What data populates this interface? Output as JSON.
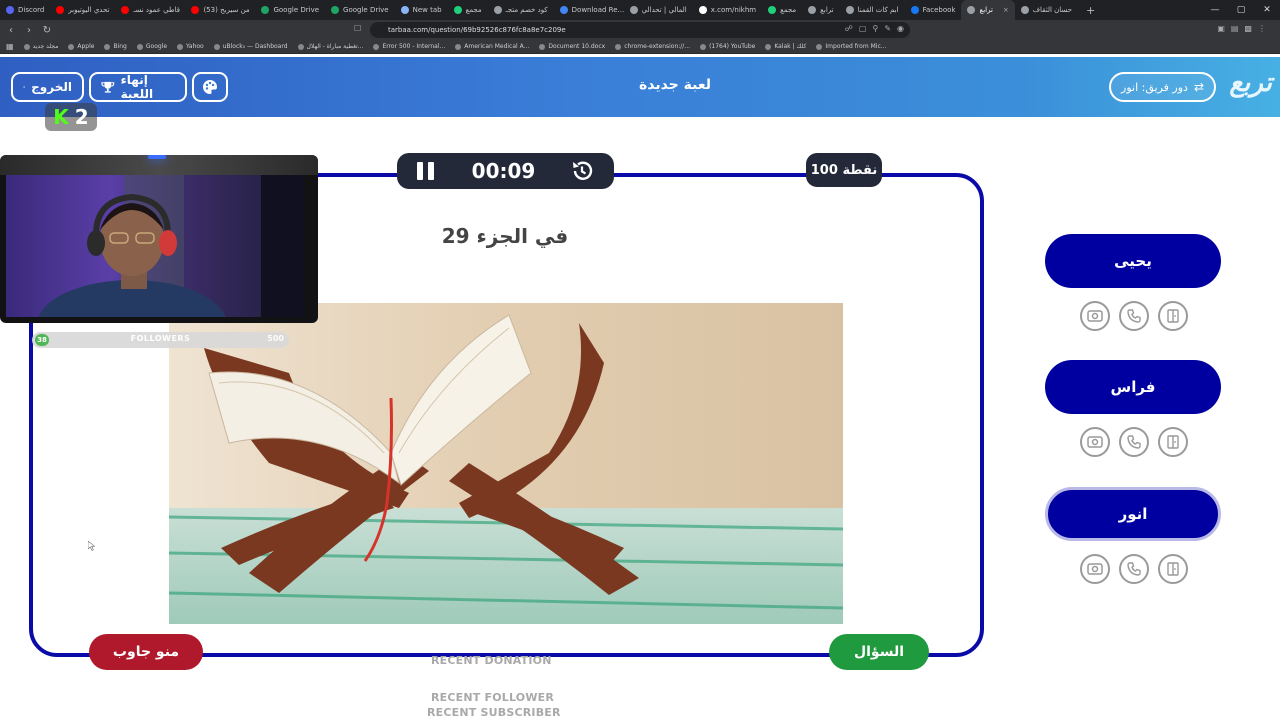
{
  "browser": {
    "tabs": [
      {
        "label": "Discord",
        "color": "#5865f2"
      },
      {
        "label": "تحدي اليوتيوبر",
        "color": "#ff0000"
      },
      {
        "label": "قاطي عمود نسـ",
        "color": "#ff0000"
      },
      {
        "label": "(53) من سيربح",
        "color": "#ff0000"
      },
      {
        "label": "Google Drive",
        "color": "#1fa463"
      },
      {
        "label": "Google Drive",
        "color": "#1fa463"
      },
      {
        "label": "New tab",
        "color": "#8ab4f8"
      },
      {
        "label": "مجمع",
        "color": "#21d07a"
      },
      {
        "label": "كود خصم متجـ",
        "color": "#9aa0a6"
      },
      {
        "label": "Download Re...",
        "color": "#4285f4"
      },
      {
        "label": "المالي | تحدالي",
        "color": "#9aa0a6"
      },
      {
        "label": "x.com/nikhm",
        "color": "#ffffff"
      },
      {
        "label": "مجمع",
        "color": "#21d07a"
      },
      {
        "label": "ترابع",
        "color": "#9aa0a6"
      },
      {
        "label": "ابم كات القمنا",
        "color": "#9aa0a6"
      },
      {
        "label": "Facebook",
        "color": "#1877f2"
      },
      {
        "label": "ترابع",
        "color": "#9aa0a6"
      },
      {
        "label": "حسان الثقاف",
        "color": "#9aa0a6"
      }
    ],
    "active_tab_index": 16,
    "url": "tarbaa.com/question/69b92526c876fc8a8e7c209e",
    "bookmarks": [
      "مجلد جديد",
      "Apple",
      "Bing",
      "Google",
      "Yahoo",
      "uBlock₀ — Dashboard",
      "تغطية مباراة - الهلال...",
      "Error 500 - Internal...",
      "American Medical A...",
      "Document 10.docx",
      "chrome-extension://...",
      "(1764) YouTube",
      "Kalak | كلك",
      "Imported from Mic..."
    ]
  },
  "header": {
    "exit_label": "الخروج",
    "end_game_label": "إنهاء اللعبة",
    "title": "لعبة جديدة",
    "turn_label": "دور فريق: انور",
    "logo_text": "تربع",
    "gradient_start": "#2f5fc2",
    "gradient_end": "#47b0e3"
  },
  "game": {
    "timer": "00:09",
    "points": "100 نقطة",
    "question": "في الجزء 29",
    "image_icon": "quran-on-rehal-image",
    "question_button": "السؤال",
    "who_answered_button": "منو جاوب",
    "frame_color": "#0a0aa8",
    "question_button_color": "#1f9a3e",
    "who_answered_color": "#b0182b"
  },
  "teams": [
    {
      "name": "يحيى",
      "active": false
    },
    {
      "name": "فراس",
      "active": false
    },
    {
      "name": "انور",
      "active": true
    }
  ],
  "team_color": "#0000a0",
  "lifelines": [
    "image-swap-icon",
    "phone-icon",
    "door-icon"
  ],
  "stream_overlay": {
    "kick_count": "2",
    "followers_label": "FOLLOWERS",
    "followers_current": "38",
    "followers_goal": "500",
    "recent_donation": "RECENT DONATION",
    "recent_follower": "RECENT FOLLOWER",
    "recent_subscriber": "RECENT SUBSCRIBER"
  }
}
